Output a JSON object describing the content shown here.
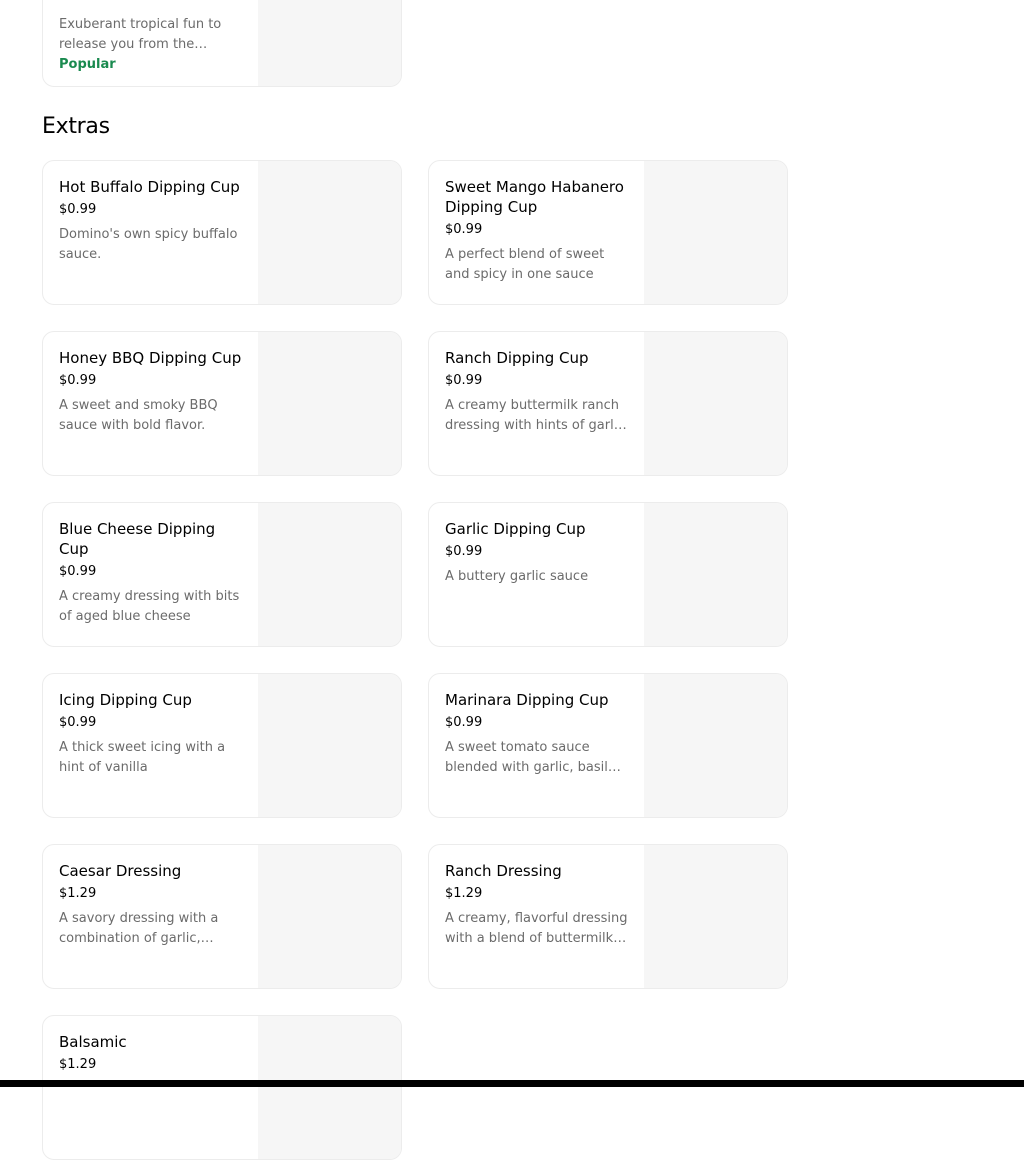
{
  "top_item": {
    "description": "Exuberant tropical fun to release you from the everyday",
    "badge": "Popular"
  },
  "section": {
    "title": "Extras"
  },
  "items": [
    {
      "name": "Hot Buffalo Dipping Cup",
      "price": "$0.99",
      "description": "Domino's own spicy buffalo sauce."
    },
    {
      "name": "Sweet Mango Habanero Dipping Cup",
      "price": "$0.99",
      "description": "A perfect blend of sweet and spicy in one sauce"
    },
    {
      "name": "Honey BBQ Dipping Cup",
      "price": "$0.99",
      "description": "A sweet and smoky BBQ sauce with bold flavor."
    },
    {
      "name": "Ranch Dipping Cup",
      "price": "$0.99",
      "description": "A creamy buttermilk ranch dressing with hints of garlic and onion"
    },
    {
      "name": "Blue Cheese Dipping Cup",
      "price": "$0.99",
      "description": "A creamy dressing with bits of aged blue cheese"
    },
    {
      "name": "Garlic Dipping Cup",
      "price": "$0.99",
      "description": "A buttery garlic sauce"
    },
    {
      "name": "Icing Dipping Cup",
      "price": "$0.99",
      "description": "A thick sweet icing with a hint of vanilla"
    },
    {
      "name": "Marinara Dipping Cup",
      "price": "$0.99",
      "description": "A sweet tomato sauce blended with garlic, basil and oregano"
    },
    {
      "name": "Caesar Dressing",
      "price": "$1.29",
      "description": "A savory dressing with a combination of garlic, parmesan and lemon"
    },
    {
      "name": "Ranch Dressing",
      "price": "$1.29",
      "description": "A creamy, flavorful dressing with a blend of buttermilk, garlic and herbs"
    },
    {
      "name": "Balsamic",
      "price": "$1.29",
      "description": ""
    }
  ]
}
